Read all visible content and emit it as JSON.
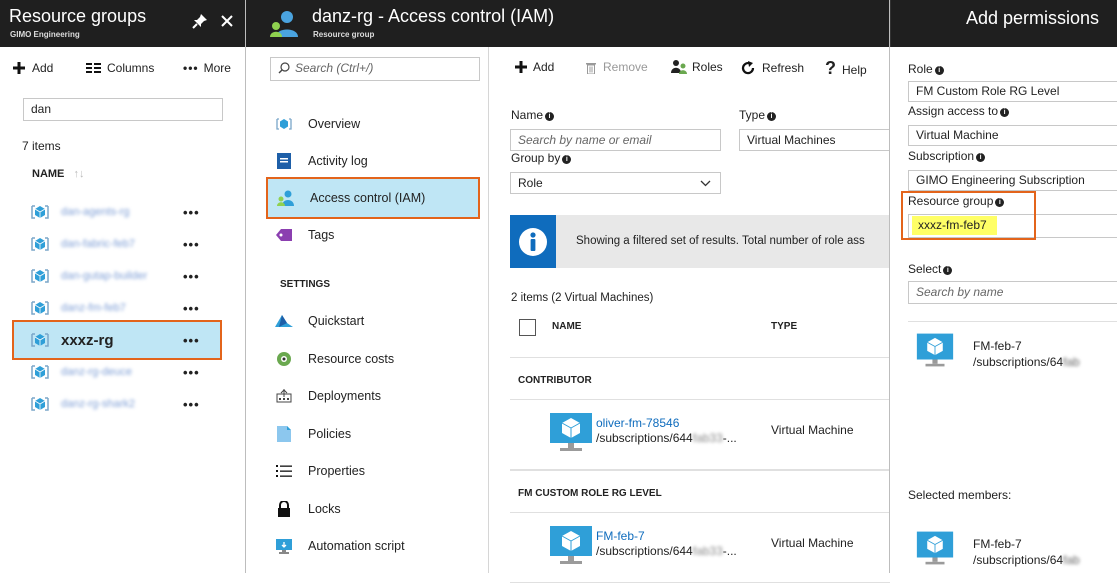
{
  "colors": {
    "accent": "#0f6cbd",
    "header": "#1f1f1f",
    "selected": "#bfe6f5",
    "highlight_orange": "#e3641b",
    "highlight_yellow": "#ffff66"
  },
  "rg_blade": {
    "title": "Resource groups",
    "subtitle": "GIMO Engineering",
    "toolbar": {
      "add": "Add",
      "columns": "Columns",
      "more": "More"
    },
    "filter_value": "dan",
    "count": "7 items",
    "col_name": "NAME",
    "items": [
      {
        "label": "dan-agents-rg",
        "blurred": true
      },
      {
        "label": "dan-fabric-feb7",
        "blurred": true
      },
      {
        "label": "dan-gutap-builder",
        "blurred": true
      },
      {
        "label": "danz-fm-feb7",
        "blurred": true
      },
      {
        "label": "xxxz-rg",
        "blurred": false,
        "selected": true
      },
      {
        "label": "danz-rg-deuce",
        "blurred": true
      },
      {
        "label": "danz-rg-shark2",
        "blurred": true
      }
    ],
    "more_label": "•••"
  },
  "rg_detail": {
    "title": "danz-rg - Access control (IAM)",
    "subtitle": "Resource group",
    "search_placeholder": "Search (Ctrl+/)",
    "menu": [
      {
        "label": "Overview",
        "icon": "overview-icon"
      },
      {
        "label": "Activity log",
        "icon": "activity-log-icon"
      },
      {
        "label": "Access control (IAM)",
        "icon": "iam-icon",
        "selected": true
      },
      {
        "label": "Tags",
        "icon": "tag-icon"
      }
    ],
    "settings_header": "SETTINGS",
    "settings_menu": [
      {
        "label": "Quickstart",
        "icon": "quickstart-icon"
      },
      {
        "label": "Resource costs",
        "icon": "resource-costs-icon"
      },
      {
        "label": "Deployments",
        "icon": "deployments-icon"
      },
      {
        "label": "Policies",
        "icon": "policies-icon"
      },
      {
        "label": "Properties",
        "icon": "properties-icon"
      },
      {
        "label": "Locks",
        "icon": "lock-icon"
      },
      {
        "label": "Automation script",
        "icon": "automation-script-icon"
      }
    ]
  },
  "iam": {
    "toolbar": {
      "add": "Add",
      "remove": "Remove",
      "roles": "Roles",
      "refresh": "Refresh",
      "help": "Help"
    },
    "name_label": "Name",
    "name_placeholder": "Search by name or email",
    "type_label": "Type",
    "type_value": "Virtual Machines",
    "groupby_label": "Group by",
    "groupby_value": "Role",
    "info_text": "Showing a filtered set of results. Total number of role ass",
    "items_count": "2 items (2 Virtual Machines)",
    "col_name": "NAME",
    "col_type": "TYPE",
    "groups": [
      {
        "role": "CONTRIBUTOR",
        "name": "oliver-fm-78546",
        "path": "/subscriptions/644",
        "path_tail": "-...",
        "type": "Virtual Machine"
      },
      {
        "role": "FM CUSTOM ROLE RG LEVEL",
        "name": "FM-feb-7",
        "path": "/subscriptions/644",
        "path_tail": "-...",
        "type": "Virtual Machine"
      }
    ]
  },
  "add_perm": {
    "title": "Add permissions",
    "role_label": "Role",
    "role_value": "FM Custom Role RG Level",
    "assign_label": "Assign access to",
    "assign_value": "Virtual Machine",
    "subscription_label": "Subscription",
    "subscription_value": "GIMO Engineering Subscription",
    "rg_label": "Resource group",
    "rg_value": "xxxz-fm-feb7",
    "select_label": "Select",
    "select_placeholder": "Search by name",
    "result": {
      "name": "FM-feb-7",
      "path": "/subscriptions/64"
    },
    "selected_members_label": "Selected members:",
    "selected": {
      "name": "FM-feb-7",
      "path": "/subscriptions/64"
    }
  }
}
